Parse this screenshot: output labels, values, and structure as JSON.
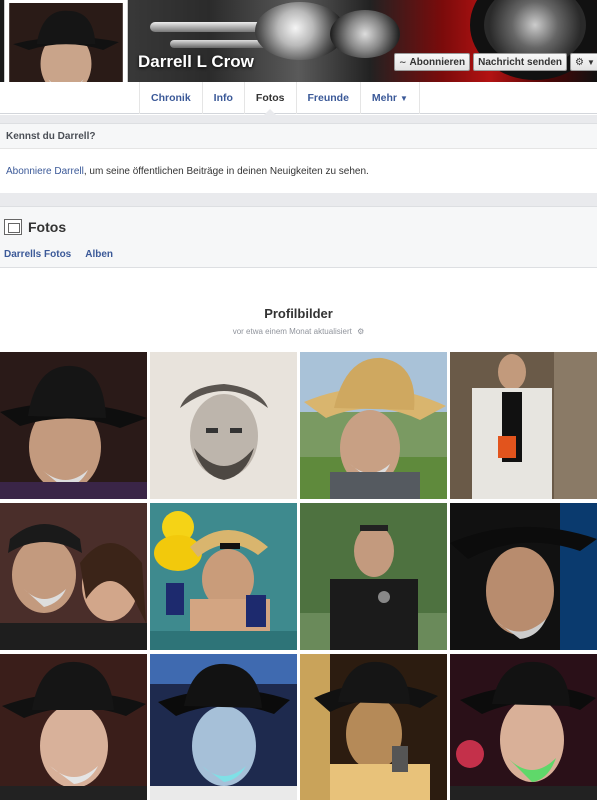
{
  "profile": {
    "name": "Darrell L Crow"
  },
  "actions": {
    "subscribe_label": "Abonnieren",
    "message_label": "Nachricht senden",
    "settings_icon": "gear-icon"
  },
  "tabs": [
    {
      "label": "Chronik"
    },
    {
      "label": "Info"
    },
    {
      "label": "Fotos",
      "active": true
    },
    {
      "label": "Freunde"
    },
    {
      "label": "Mehr"
    }
  ],
  "know": {
    "heading": "Kennst du Darrell?",
    "link_text": "Abonniere Darrell",
    "rest_text": ", um seine öffentlichen Beiträge in deinen Neuigkeiten zu sehen."
  },
  "photos": {
    "title": "Fotos",
    "links": [
      "Darrells Fotos",
      "Alben"
    ]
  },
  "album": {
    "title": "Profilbilder",
    "updated": "vor etwa einem Monat aktualisiert",
    "photo_count": 12
  },
  "colors": {
    "link_blue": "#3b5998",
    "section_bg": "#f6f7f8",
    "divider_bg": "#e9eaed"
  }
}
